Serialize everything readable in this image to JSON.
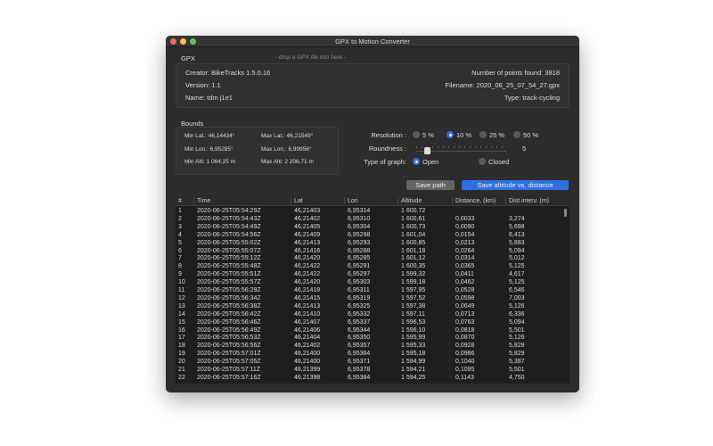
{
  "window": {
    "title": "GPX to Motion Converter"
  },
  "gpx": {
    "label": "GPX",
    "drop_hint": "- drop a GPX file into here -",
    "creator": "Creator: BikeTracks 1.5.0.16",
    "version": "Version: 1.1",
    "name": "Name: tdm j1e1",
    "points": "Number of points found: 3818",
    "filename": "Filename: 2020_06_25_07_54_27.gpx",
    "type": "Type: track-cycling"
  },
  "bounds": {
    "label": "Bounds",
    "min_lat": "Min Lat.: 46,14434°",
    "max_lat": "Max Lat.: 46,21549°",
    "min_lon": "Min Lon.: 6,95285°",
    "max_lon": "Max Lon.: 6,99956°",
    "min_alti": "Min Alti: 1 064,25 m",
    "max_alti": "Max Alti: 2 206,71 m"
  },
  "options": {
    "resolution_label": "Resolution :",
    "resolutions": [
      "5 %",
      "10 %",
      "25 %",
      "50 %"
    ],
    "resolution_selected": 1,
    "roundness_label": "Roundness :",
    "roundness_value": "5",
    "roundness_fraction": 0.1,
    "graph_label": "Type of graph:",
    "graph_open": "Open",
    "graph_closed": "Closed",
    "graph_selected": "Open"
  },
  "buttons": {
    "save_path": "Save path",
    "save_altitude": "Save altitude vs. distance"
  },
  "colors": {
    "accent": "#2f6fe0"
  },
  "table": {
    "headers": [
      "#",
      "Time",
      "Lat",
      "Lon",
      "Altitude",
      "Distance, (km)",
      "Dist.interv. (m)"
    ],
    "rows": [
      [
        "1",
        "2020-06-25T05:54:29Z",
        "46,21403",
        "6,95314",
        "1 600,72",
        "",
        ""
      ],
      [
        "2",
        "2020-06-25T05:54:43Z",
        "46,21402",
        "6,95310",
        "1 600,61",
        "0,0033",
        "3,274"
      ],
      [
        "3",
        "2020-06-25T05:54:49Z",
        "46,21405",
        "6,95304",
        "1 600,73",
        "0,0090",
        "5,698"
      ],
      [
        "4",
        "2020-06-25T05:54:56Z",
        "46,21409",
        "6,95298",
        "1 601,04",
        "0,0154",
        "6,413"
      ],
      [
        "5",
        "2020-06-25T05:55:02Z",
        "46,21413",
        "6,95293",
        "1 600,85",
        "0,0213",
        "5,883"
      ],
      [
        "6",
        "2020-06-25T05:55:07Z",
        "46,21416",
        "6,95288",
        "1 601,18",
        "0,0264",
        "5,094"
      ],
      [
        "7",
        "2020-06-25T05:55:12Z",
        "46,21420",
        "6,95285",
        "1 601,12",
        "0,0314",
        "5,012"
      ],
      [
        "8",
        "2020-06-25T05:55:48Z",
        "46,21422",
        "6,95291",
        "1 600,35",
        "0,0365",
        "5,125"
      ],
      [
        "9",
        "2020-06-25T05:55:51Z",
        "46,21422",
        "6,95297",
        "1 599,32",
        "0,0411",
        "4,617"
      ],
      [
        "10",
        "2020-06-25T05:55:57Z",
        "46,21420",
        "6,95303",
        "1 599,18",
        "0,0462",
        "5,125"
      ],
      [
        "11",
        "2020-06-25T05:56:29Z",
        "46,21418",
        "6,95311",
        "1 597,95",
        "0,0528",
        "6,546"
      ],
      [
        "12",
        "2020-06-25T05:56:34Z",
        "46,21415",
        "6,95319",
        "1 597,52",
        "0,0598",
        "7,003"
      ],
      [
        "13",
        "2020-06-25T05:56:38Z",
        "46,21413",
        "6,95325",
        "1 597,38",
        "0,0649",
        "5,126"
      ],
      [
        "14",
        "2020-06-25T05:56:42Z",
        "46,21410",
        "6,95332",
        "1 597,11",
        "0,0713",
        "6,336"
      ],
      [
        "15",
        "2020-06-25T05:56:46Z",
        "46,21407",
        "6,95337",
        "1 596,53",
        "0,0763",
        "5,094"
      ],
      [
        "16",
        "2020-06-25T05:56:49Z",
        "46,21406",
        "6,95344",
        "1 596,10",
        "0,0818",
        "5,501"
      ],
      [
        "17",
        "2020-06-25T05:56:53Z",
        "46,21404",
        "6,95350",
        "1 595,99",
        "0,0870",
        "5,126"
      ],
      [
        "18",
        "2020-06-25T05:56:56Z",
        "46,21402",
        "6,95357",
        "1 595,33",
        "0,0928",
        "5,828"
      ],
      [
        "19",
        "2020-06-25T05:57:01Z",
        "46,21400",
        "6,95364",
        "1 595,18",
        "0,0986",
        "5,829"
      ],
      [
        "20",
        "2020-06-25T05:57:05Z",
        "46,21400",
        "6,95371",
        "1 594,99",
        "0,1040",
        "5,387"
      ],
      [
        "21",
        "2020-06-25T05:57:11Z",
        "46,21399",
        "6,95378",
        "1 594,21",
        "0,1095",
        "5,501"
      ],
      [
        "22",
        "2020-06-25T05:57:16Z",
        "46,21398",
        "6,95384",
        "1 594,25",
        "0,1143",
        "4,750"
      ]
    ]
  }
}
